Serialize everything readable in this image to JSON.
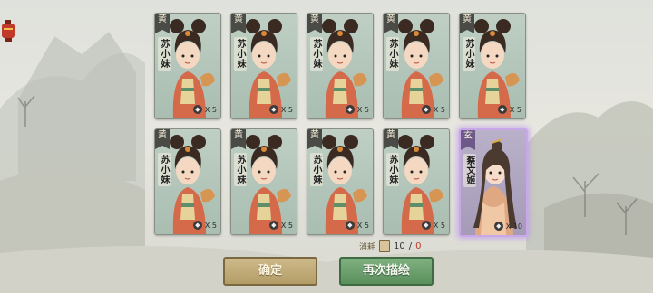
{
  "cards": [
    {
      "rarity": "黄",
      "name": "苏小妹",
      "count": "X 5"
    },
    {
      "rarity": "黄",
      "name": "苏小妹",
      "count": "X 5"
    },
    {
      "rarity": "黄",
      "name": "苏小妹",
      "count": "X 5"
    },
    {
      "rarity": "黄",
      "name": "苏小妹",
      "count": "X 5"
    },
    {
      "rarity": "黄",
      "name": "苏小妹",
      "count": "X 5"
    },
    {
      "rarity": "黄",
      "name": "苏小妹",
      "count": "X 5"
    },
    {
      "rarity": "黄",
      "name": "苏小妹",
      "count": "X 5"
    },
    {
      "rarity": "黄",
      "name": "苏小妹",
      "count": "X 5"
    },
    {
      "rarity": "黄",
      "name": "苏小妹",
      "count": "X 5"
    },
    {
      "rarity": "玄",
      "name": "蔡文姬",
      "count": "X 10"
    }
  ],
  "cost": {
    "label": "消耗",
    "current": "10",
    "separator": "/",
    "remaining": "0"
  },
  "buttons": {
    "confirm": "确定",
    "redraw": "再次描绘"
  },
  "colors": {
    "common_card": "#a9bdb1",
    "rare_card": "#a59bb8",
    "rare_glow": "#c8a8e8",
    "confirm_btn": "#b39c66",
    "redraw_btn": "#5a8f5c"
  },
  "icons": {
    "corner": "lantern-icon",
    "cost": "scroll-icon",
    "count": "shard-icon"
  }
}
